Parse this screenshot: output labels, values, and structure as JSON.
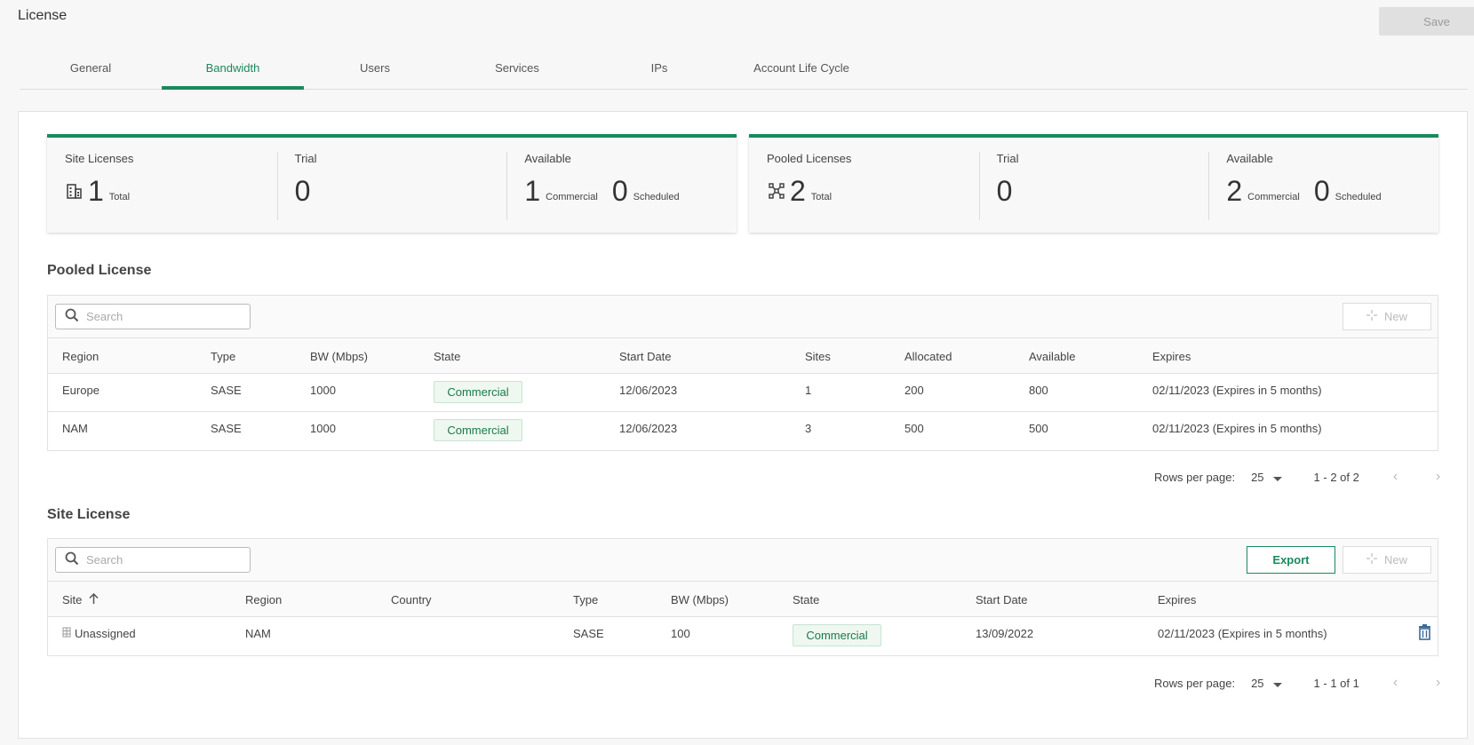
{
  "page": {
    "title": "License",
    "save_label": "Save"
  },
  "tabs": [
    {
      "label": "General",
      "active": false
    },
    {
      "label": "Bandwidth",
      "active": true
    },
    {
      "label": "Users",
      "active": false
    },
    {
      "label": "Services",
      "active": false
    },
    {
      "label": "IPs",
      "active": false
    },
    {
      "label": "Account Life Cycle",
      "active": false
    }
  ],
  "site_card": {
    "label": "Site Licenses",
    "total": "1",
    "total_label": "Total",
    "trial_label": "Trial",
    "trial": "0",
    "available_label": "Available",
    "commercial": "1",
    "commercial_label": "Commercial",
    "scheduled": "0",
    "scheduled_label": "Scheduled"
  },
  "pooled_card": {
    "label": "Pooled Licenses",
    "total": "2",
    "total_label": "Total",
    "trial_label": "Trial",
    "trial": "0",
    "available_label": "Available",
    "commercial": "2",
    "commercial_label": "Commercial",
    "scheduled": "0",
    "scheduled_label": "Scheduled"
  },
  "pooled": {
    "title": "Pooled License",
    "search_placeholder": "Search",
    "new_label": "New",
    "columns": [
      "Region",
      "Type",
      "BW (Mbps)",
      "State",
      "Start Date",
      "Sites",
      "Allocated",
      "Available",
      "Expires"
    ],
    "rows": [
      [
        "Europe",
        "SASE",
        "1000",
        "Commercial",
        "12/06/2023",
        "1",
        "200",
        "800",
        "02/11/2023 (Expires in 5 months)"
      ],
      [
        "NAM",
        "SASE",
        "1000",
        "Commercial",
        "12/06/2023",
        "3",
        "500",
        "500",
        "02/11/2023 (Expires in 5 months)"
      ]
    ],
    "rows_per_page_label": "Rows per page:",
    "rows_per_page": "25",
    "range": "1 - 2 of 2"
  },
  "site": {
    "title": "Site License",
    "search_placeholder": "Search",
    "export_label": "Export",
    "new_label": "New",
    "columns": [
      "Site",
      "Region",
      "Country",
      "Type",
      "BW (Mbps)",
      "State",
      "Start Date",
      "Expires"
    ],
    "rows": [
      [
        "Unassigned",
        "NAM",
        "",
        "SASE",
        "100",
        "Commercial",
        "13/09/2022",
        "02/11/2023 (Expires in 5 months)"
      ]
    ],
    "rows_per_page_label": "Rows per page:",
    "rows_per_page": "25",
    "range": "1 - 1 of 1"
  },
  "colors": {
    "accent": "#1a8a5a"
  }
}
